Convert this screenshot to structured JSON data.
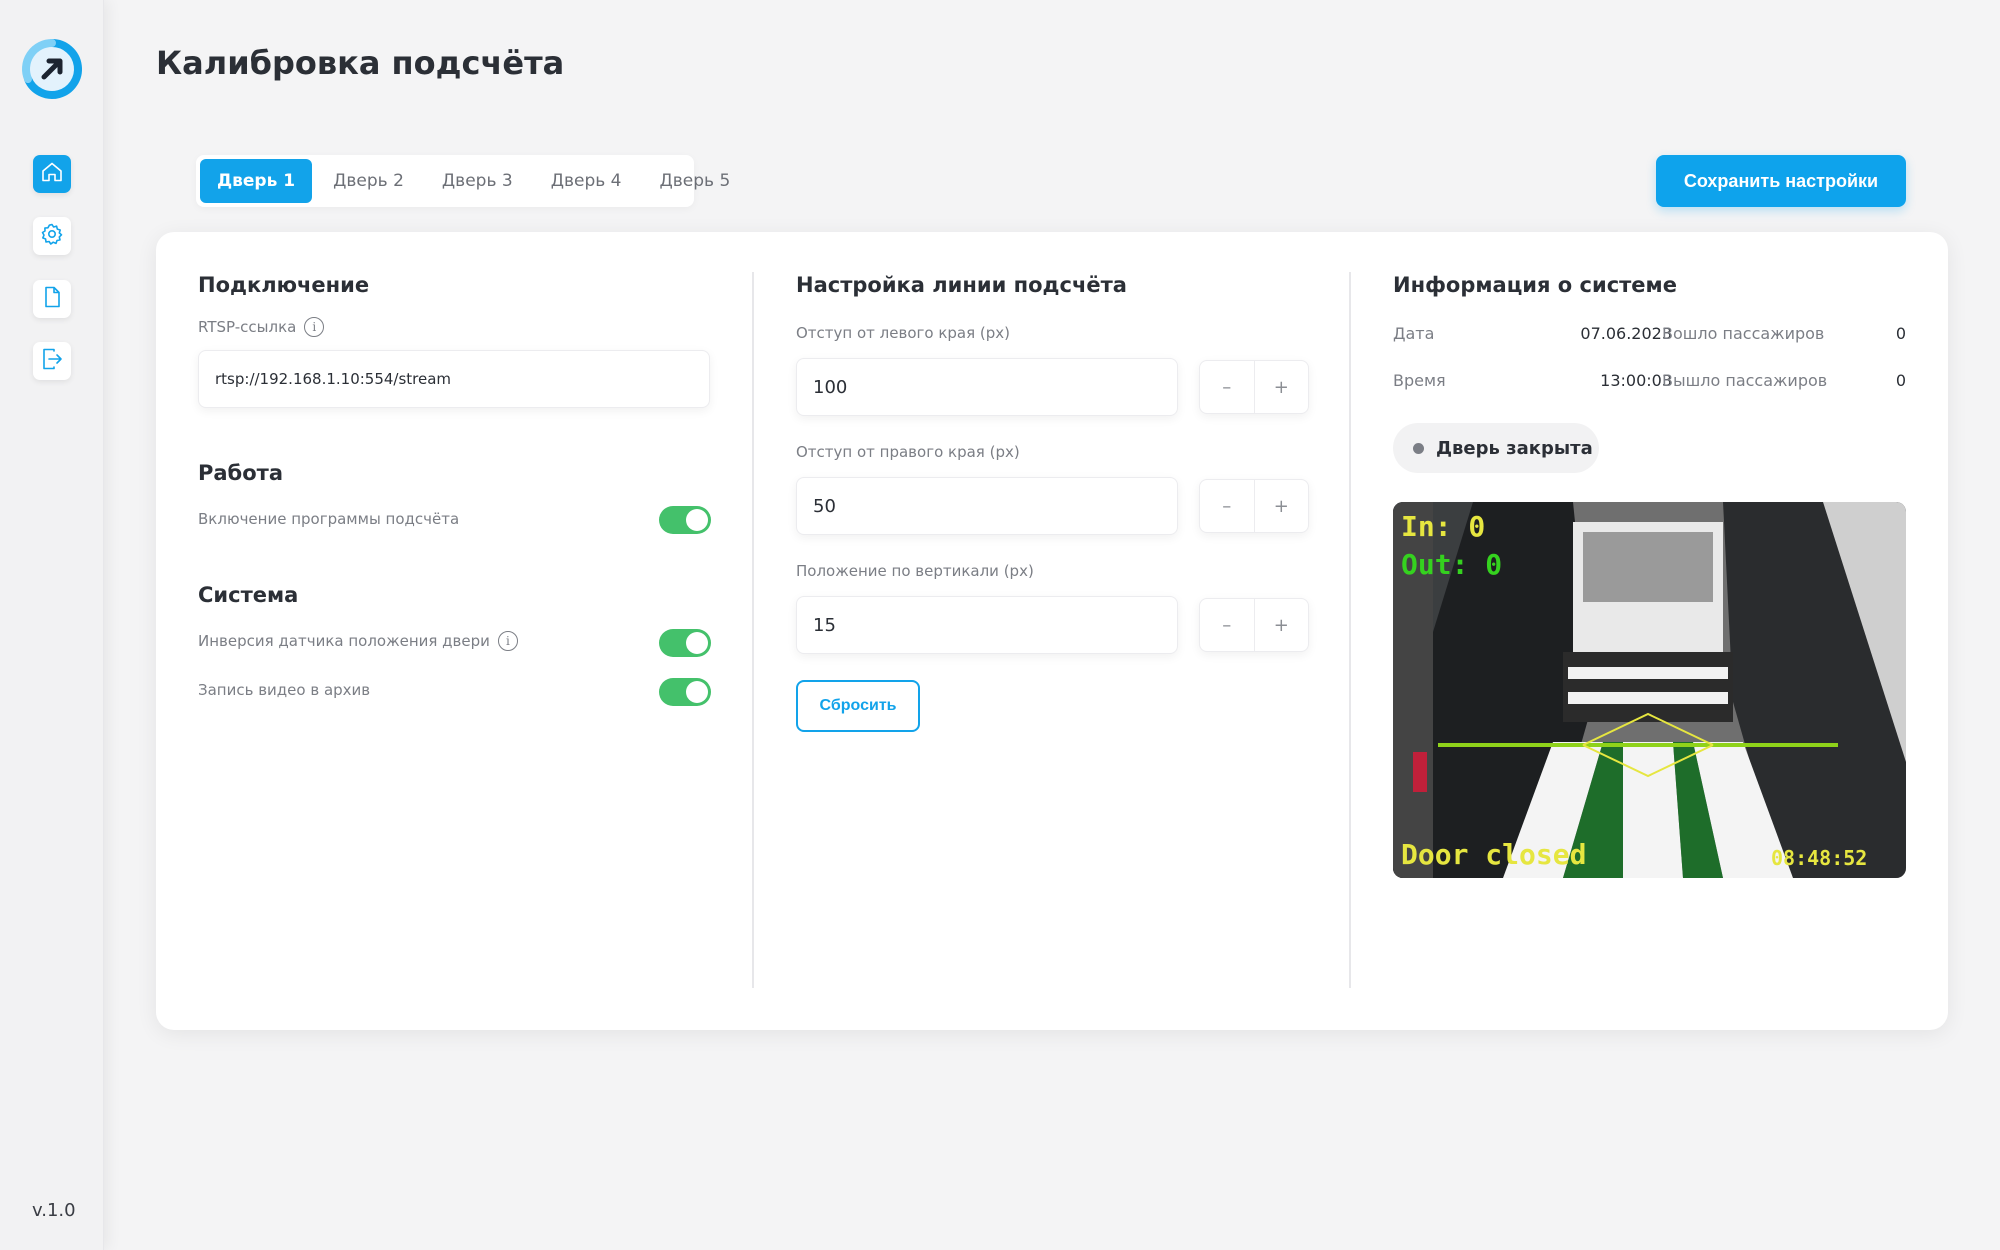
{
  "app": {
    "title": "Калибровка подсчёта",
    "version": "v.1.0"
  },
  "sidebar": {
    "items": [
      {
        "icon": "home-icon",
        "active": true
      },
      {
        "icon": "gear-icon",
        "active": false
      },
      {
        "icon": "document-icon",
        "active": false
      },
      {
        "icon": "logout-icon",
        "active": false
      }
    ]
  },
  "tabs": [
    "Дверь 1",
    "Дверь 2",
    "Дверь 3",
    "Дверь 4",
    "Дверь 5"
  ],
  "active_tab": "Дверь 1",
  "save_label": "Сохранить настройки",
  "connection": {
    "title": "Подключение",
    "rtsp_label": "RTSP-ссылка",
    "rtsp_value": "rtsp://192.168.1.10:554/stream"
  },
  "work": {
    "title": "Работа",
    "toggle_label": "Включение программы подсчёта",
    "toggle_on": true
  },
  "system": {
    "title": "Система",
    "inversion_label": "Инверсия датчика положения двери",
    "inversion_on": true,
    "record_label": "Запись видео в архив",
    "record_on": true
  },
  "line": {
    "title": "Настройка линии подсчёта",
    "left_label": "Отступ от левого края (px)",
    "left_value": "100",
    "right_label": "Отступ от правого края (px)",
    "right_value": "50",
    "vertical_label": "Положение по вертикали (px)",
    "vertical_value": "15",
    "minus": "–",
    "plus": "+",
    "reset_label": "Сбросить"
  },
  "info": {
    "title": "Информация о системе",
    "date_label": "Дата",
    "date_value": "07.06.2023",
    "time_label": "Время",
    "time_value": "13:00:03",
    "in_label": "Вошло пассажиров",
    "in_value": "0",
    "out_label": "Вышло пассажиров",
    "out_value": "0",
    "door_status": "Дверь закрыта"
  },
  "camera": {
    "in_text": "In: 0",
    "out_text": "Out: 0",
    "door_text": "Door closed",
    "timestamp": "08:48:52"
  },
  "colors": {
    "accent": "#12a3ea",
    "toggle_on": "#44c16b",
    "overlay_green": "#35d21f",
    "overlay_yellow": "#e6e640"
  }
}
